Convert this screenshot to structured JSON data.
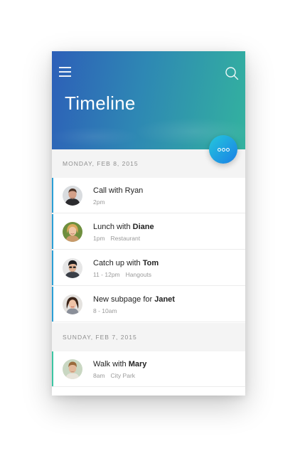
{
  "header": {
    "title": "Timeline"
  },
  "sections": [
    {
      "label": "MONDAY, FEB 8, 2015",
      "events": [
        {
          "title_prefix": "Call with Ryan",
          "title_name": "",
          "time": "2pm",
          "place": "",
          "accent": "#2b9fd6"
        },
        {
          "title_prefix": "Lunch with ",
          "title_name": "Diane",
          "time": "1pm",
          "place": "Restaurant",
          "accent": "#2b9fd6"
        },
        {
          "title_prefix": "Catch up with ",
          "title_name": "Tom",
          "time": "11 - 12pm",
          "place": "Hangouts",
          "accent": "#2b9fd6"
        },
        {
          "title_prefix": "New subpage for ",
          "title_name": "Janet",
          "time": "8 - 10am",
          "place": "",
          "accent": "#2b9fd6"
        }
      ]
    },
    {
      "label": "SUNDAY, FEB 7, 2015",
      "events": [
        {
          "title_prefix": "Walk with ",
          "title_name": "Mary",
          "time": "8am",
          "place": "City Park",
          "accent": "#3cc6a3"
        }
      ]
    }
  ],
  "icons": {
    "menu": "menu-icon",
    "search": "search-icon",
    "fab": "more-dots-icon"
  },
  "colors": {
    "header_start": "#2d5fb8",
    "header_end": "#33b29f",
    "fab_start": "#24c7dc",
    "fab_end": "#1a7fe6"
  }
}
